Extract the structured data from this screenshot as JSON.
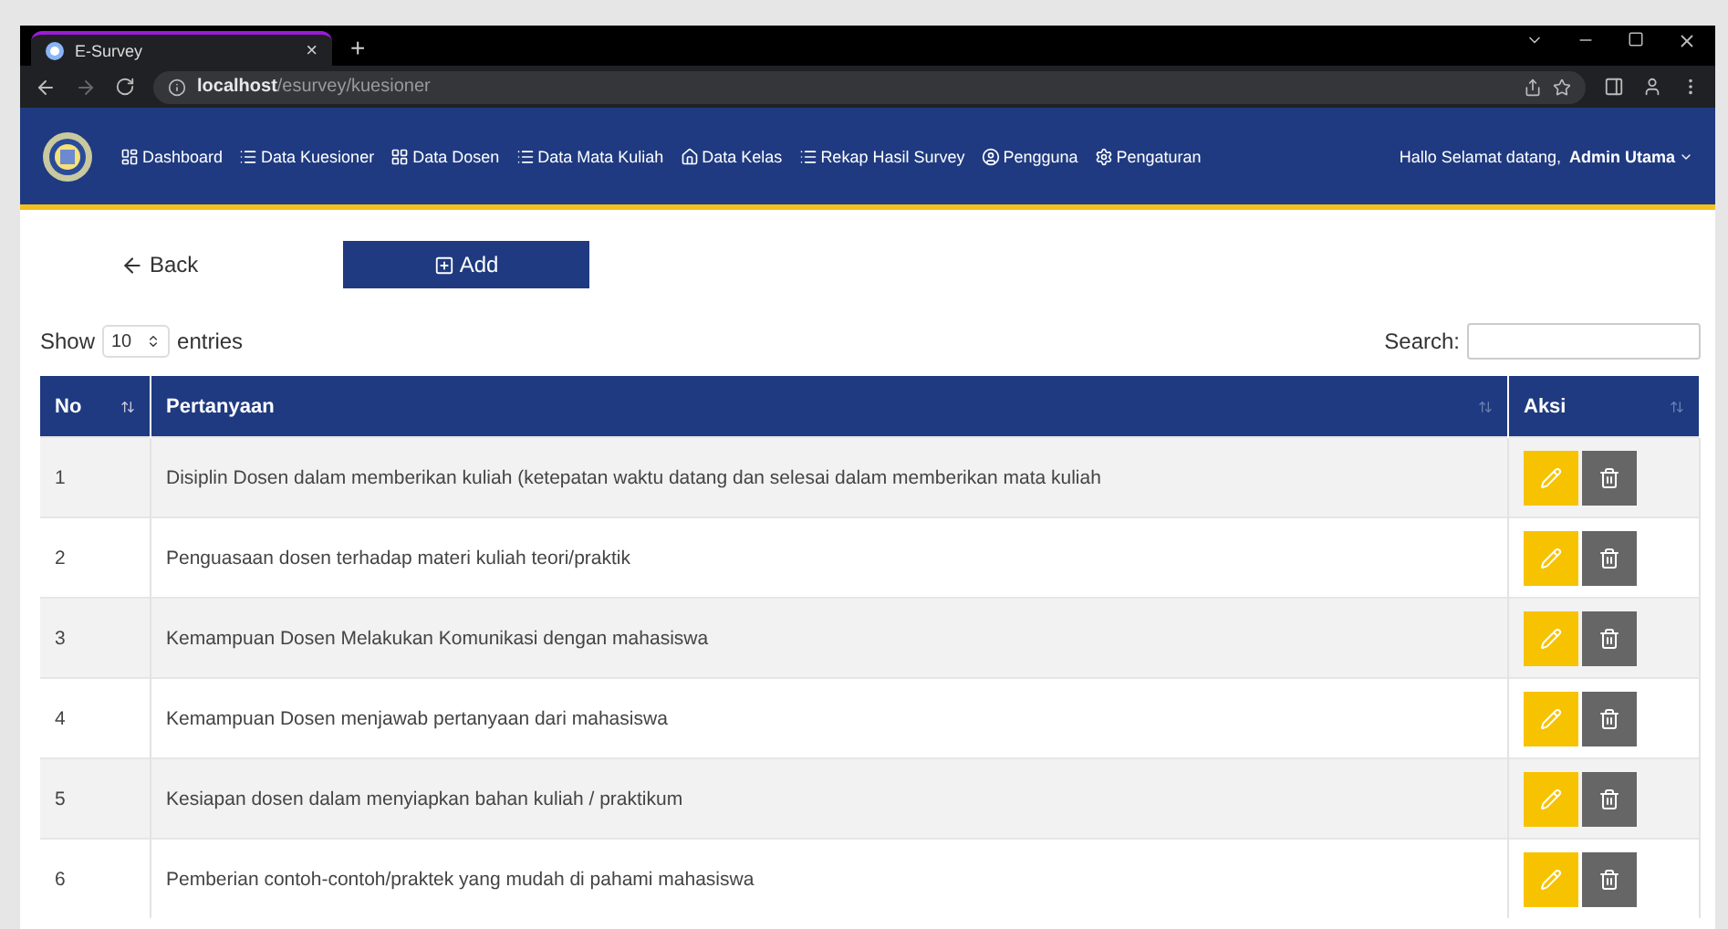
{
  "browser": {
    "tab_title": "E-Survey",
    "tab_close": "×",
    "new_tab": "+",
    "url_host": "localhost",
    "url_path": "/esurvey/kuesioner"
  },
  "navbar": {
    "items": [
      {
        "label": "Dashboard",
        "kind": "dashboard"
      },
      {
        "label": "Data Kuesioner",
        "kind": "list"
      },
      {
        "label": "Data Dosen",
        "kind": "grid"
      },
      {
        "label": "Data Mata Kuliah",
        "kind": "list"
      },
      {
        "label": "Data Kelas",
        "kind": "home"
      },
      {
        "label": "Rekap Hasil Survey",
        "kind": "list"
      },
      {
        "label": "Pengguna",
        "kind": "user"
      },
      {
        "label": "Pengaturan",
        "kind": "gear"
      }
    ],
    "greeting": "Hallo Selamat datang,",
    "user": "Admin Utama"
  },
  "actions": {
    "back": "Back",
    "add": "Add"
  },
  "length": {
    "show": "Show",
    "value": "10",
    "entries": "entries"
  },
  "search": {
    "label": "Search:"
  },
  "table": {
    "columns": [
      "No",
      "Pertanyaan",
      "Aksi"
    ],
    "rows": [
      {
        "no": "1",
        "question": "Disiplin Dosen dalam memberikan kuliah (ketepatan waktu datang dan selesai dalam memberikan mata kuliah"
      },
      {
        "no": "2",
        "question": "Penguasaan dosen terhadap materi kuliah teori/praktik"
      },
      {
        "no": "3",
        "question": "Kemampuan Dosen Melakukan Komunikasi dengan mahasiswa"
      },
      {
        "no": "4",
        "question": "Kemampuan Dosen menjawab pertanyaan dari mahasiswa"
      },
      {
        "no": "5",
        "question": "Kesiapan dosen dalam menyiapkan bahan kuliah / praktikum"
      },
      {
        "no": "6",
        "question": "Pemberian contoh-contoh/praktek yang mudah di pahami mahasiswa"
      }
    ]
  }
}
